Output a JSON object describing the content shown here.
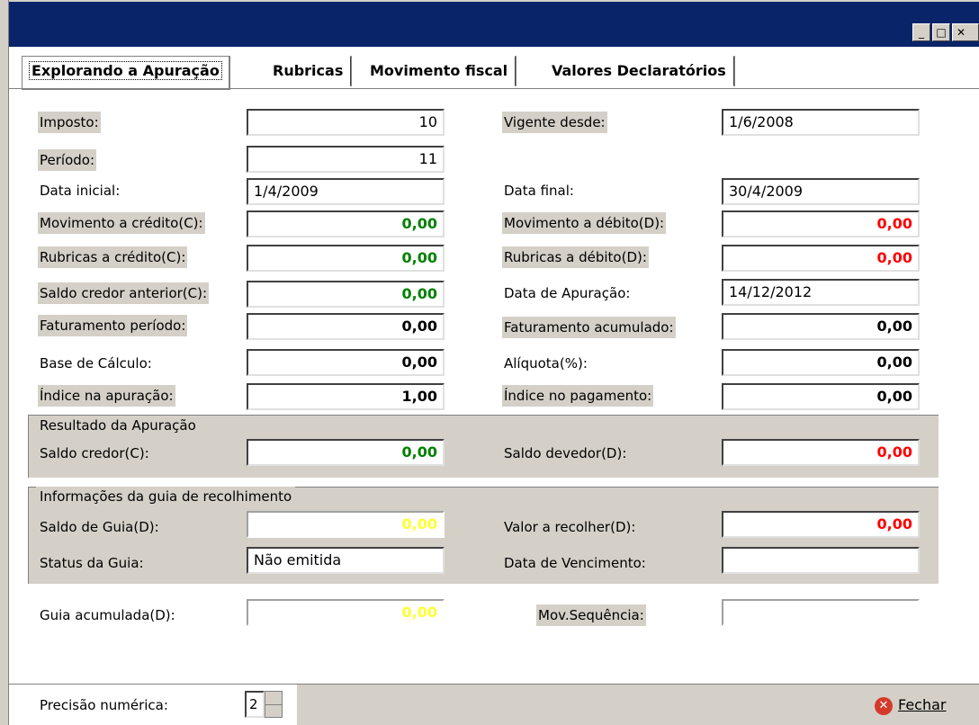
{
  "window": {
    "minimize": "_",
    "maximize": "□",
    "close": "✕"
  },
  "tabs": [
    "Explorando a Apuração",
    "Rubricas",
    "Movimento fiscal",
    "Valores Declaratórios"
  ],
  "fields": {
    "imposto": {
      "label": "Imposto:",
      "value": "10"
    },
    "vigente_desde": {
      "label": "Vigente desde:",
      "value": "1/6/2008"
    },
    "periodo": {
      "label": "Período:",
      "value": "11"
    },
    "data_inicial": {
      "label": "Data inicial:",
      "value": "1/4/2009"
    },
    "data_final": {
      "label": "Data final:",
      "value": "30/4/2009"
    },
    "mov_credito": {
      "label": "Movimento a crédito(C):",
      "value": "0,00"
    },
    "mov_debito": {
      "label": "Movimento a débito(D):",
      "value": "0,00"
    },
    "rub_credito": {
      "label": "Rubricas a crédito(C):",
      "value": "0,00"
    },
    "rub_debito": {
      "label": "Rubricas a débito(D):",
      "value": "0,00"
    },
    "saldo_credor_ant": {
      "label": "Saldo credor anterior(C):",
      "value": "0,00"
    },
    "data_apuracao": {
      "label": "Data de Apuração:",
      "value": "14/12/2012"
    },
    "fat_periodo": {
      "label": "Faturamento período:",
      "value": "0,00"
    },
    "fat_acumulado": {
      "label": "Faturamento acumulado:",
      "value": "0,00"
    },
    "base_calculo": {
      "label": "Base de Cálculo:",
      "value": "0,00"
    },
    "aliquota": {
      "label": "Alíquota(%):",
      "value": "0,00"
    },
    "indice_apuracao": {
      "label": "Índice na apuração:",
      "value": "1,00"
    },
    "indice_pagamento": {
      "label": "Índice no pagamento:",
      "value": "0,00"
    }
  },
  "resultado": {
    "title": "Resultado da Apuração",
    "saldo_credor": {
      "label": "Saldo credor(C):",
      "value": "0,00"
    },
    "saldo_devedor": {
      "label": "Saldo devedor(D):",
      "value": "0,00"
    }
  },
  "guia": {
    "title": "Informações da guia de recolhimento",
    "saldo_guia": {
      "label": "Saldo de Guia(D):",
      "value": "0,00"
    },
    "valor_recolher": {
      "label": "Valor a recolher(D):",
      "value": "0,00"
    },
    "status": {
      "label": "Status da Guia:",
      "value": "Não emitida"
    },
    "vencimento": {
      "label": "Data de Vencimento:",
      "value": ""
    }
  },
  "guia_acumulada": {
    "label": "Guia acumulada(D):",
    "value": "0,00"
  },
  "mov_sequencia": {
    "label": "Mov.Sequência:",
    "value": ""
  },
  "footer": {
    "precisao_label": "Precisão numérica:",
    "precisao_value": "2",
    "fechar_label": "Fechar"
  },
  "colors": {
    "title_bar": "#0a246a",
    "face": "#d4d0c8",
    "credit": "#008000",
    "debit": "#ff0000",
    "guia": "#ffff33"
  }
}
